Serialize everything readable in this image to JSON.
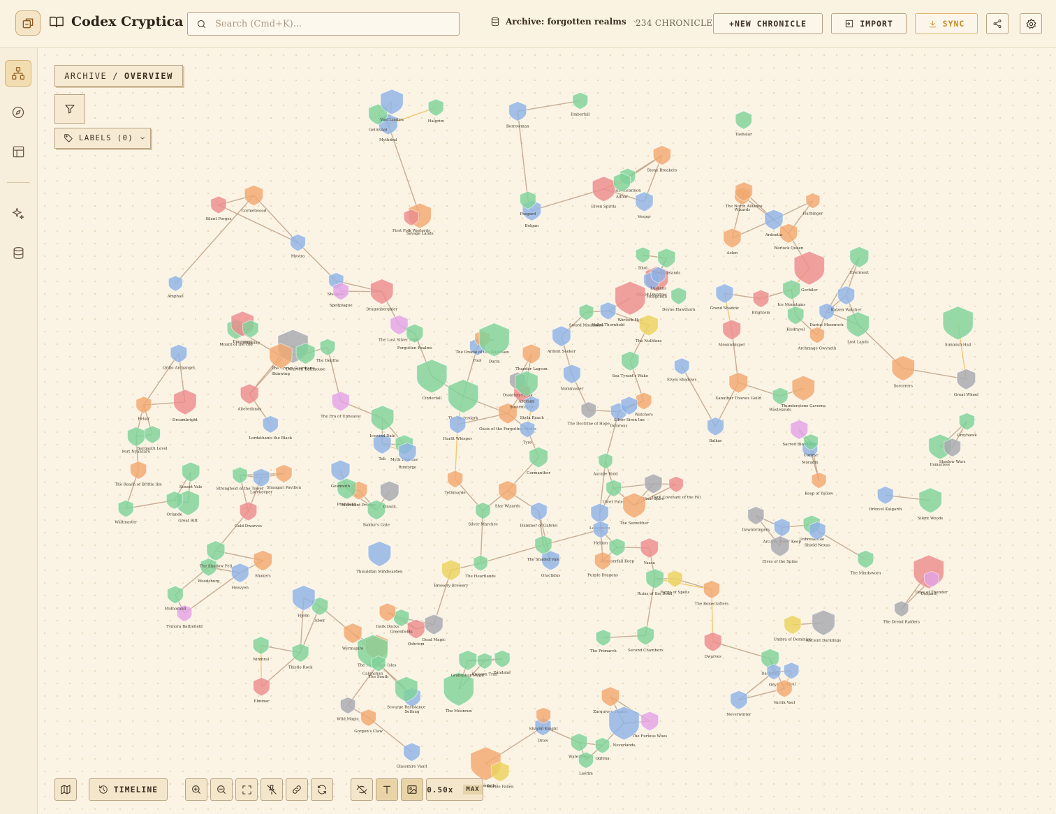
{
  "header": {
    "app_title": "Codex Cryptica",
    "search_placeholder": "Search (Cmd+K)...",
    "archive_label": "Archive: forgotten realms",
    "chronicle_count": "234 CHRONICLES",
    "new_chronicle_label": "+NEW CHRONICLE",
    "import_label": "IMPORT",
    "sync_label": "SYNC"
  },
  "rail": {
    "items": [
      "graph-view",
      "explore",
      "layout",
      "oracle",
      "database"
    ]
  },
  "canvas": {
    "breadcrumb_root": "ARCHIVE",
    "breadcrumb_sep": "/",
    "breadcrumb_current": "OVERVIEW",
    "labels_button": "LABELS (0)"
  },
  "toolbar": {
    "timeline_label": "TIMELINE",
    "zoom_value": "0.50x",
    "zoom_max": "MAX"
  },
  "colors": {
    "background": "#fbf4e4",
    "location": "#7fd39a",
    "character": "#8fb3e6",
    "item": "#f2a86f",
    "faction": "#ec8c8c",
    "event": "#a7aab0",
    "magic": "#e3a3e6",
    "lore": "#ecd35e",
    "link": "#b89a80",
    "highlight_link": "#f0c060",
    "accent": "#c58b24"
  },
  "graph_nodes": [
    {
      "label": "Ilsmarisse",
      "type": "location"
    },
    {
      "label": "Oractidus",
      "type": "character"
    },
    {
      "label": "Selfaug",
      "type": "character"
    },
    {
      "label": "Gerbilor",
      "type": "faction"
    },
    {
      "label": "Zarquivan Trader",
      "type": "item"
    },
    {
      "label": "Bolgan",
      "type": "character"
    },
    {
      "label": "Balkar",
      "type": "character"
    },
    {
      "label": "Tok",
      "type": "character"
    },
    {
      "label": "Brewery Brewery",
      "type": "lore"
    },
    {
      "label": "Dragonbergbier",
      "type": "faction"
    },
    {
      "label": "Hammerfall Keep",
      "type": "location"
    },
    {
      "label": "Waltmaster",
      "type": "location"
    },
    {
      "label": "Oshriem",
      "type": "faction"
    },
    {
      "label": "Xanathar Thieves Guild",
      "type": "item"
    },
    {
      "label": "Second Chambers",
      "type": "location"
    },
    {
      "label": "Auralie Hold",
      "type": "location"
    },
    {
      "label": "Brightem",
      "type": "faction"
    },
    {
      "label": "Grul",
      "type": "character"
    },
    {
      "label": "Hobgoblin",
      "type": "faction"
    },
    {
      "label": "Moradin",
      "type": "character"
    },
    {
      "label": "The Moonrun",
      "type": "location"
    },
    {
      "label": "Purple Dragons",
      "type": "item"
    },
    {
      "label": "Dark Covenant of the Fel",
      "type": "faction"
    },
    {
      "label": "Sargauth Level",
      "type": "location"
    },
    {
      "label": "Shagguit",
      "type": "character"
    },
    {
      "label": "Stone Breakers",
      "type": "item"
    },
    {
      "label": "Ice Mountains",
      "type": "location"
    },
    {
      "label": "The Moonshae Isles",
      "type": "item"
    },
    {
      "label": "Myth Drannor",
      "type": "location"
    },
    {
      "label": "Silent Forges",
      "type": "faction"
    },
    {
      "label": "Alteredimas",
      "type": "faction"
    },
    {
      "label": "Unicorn Trail",
      "type": "location"
    },
    {
      "label": "The Bonecrafters",
      "type": "item"
    },
    {
      "label": "Shield Dwarves",
      "type": "character"
    },
    {
      "label": "Dwarves",
      "type": "faction"
    },
    {
      "label": "Gold Dwarves",
      "type": "faction"
    },
    {
      "label": "Great Rift",
      "type": "location"
    },
    {
      "label": "Chondath",
      "type": "item"
    },
    {
      "label": "The Dread Raiders",
      "type": "event"
    },
    {
      "label": "Darthfall",
      "type": "location"
    },
    {
      "label": "Shieldcannon",
      "type": "location"
    },
    {
      "label": "The Primarch",
      "type": "location"
    },
    {
      "label": "Wizards",
      "type": "item"
    },
    {
      "label": "Wild Magic",
      "type": "event"
    },
    {
      "label": "Cormanthor",
      "type": "location"
    },
    {
      "label": "Elven Spirits",
      "type": "faction"
    },
    {
      "label": "The Heartlands",
      "type": "location"
    },
    {
      "label": "Star Wizards",
      "type": "item"
    },
    {
      "label": "Watchers",
      "type": "item"
    },
    {
      "label": "Dawnbringers",
      "type": "event"
    },
    {
      "label": "Abeir",
      "type": "location"
    },
    {
      "label": "Sacred Bloodline",
      "type": "magic"
    },
    {
      "label": "The Era of Upheaval",
      "type": "magic"
    },
    {
      "label": "Hallol Thornhold",
      "type": "character"
    },
    {
      "label": "The Crown Guardians",
      "type": "event"
    },
    {
      "label": "Dead Magic",
      "type": "event"
    },
    {
      "label": "The Reach of Brittle Inn",
      "type": "item"
    },
    {
      "label": "Woodsburg",
      "type": "location"
    },
    {
      "label": "Spellplague",
      "type": "magic"
    },
    {
      "label": "The Depths",
      "type": "location"
    },
    {
      "label": "Fool",
      "type": "character"
    },
    {
      "label": "Shadow Wars",
      "type": "event"
    },
    {
      "label": "The Doctrine of Hope",
      "type": "event"
    },
    {
      "label": "Sorcerers",
      "type": "item"
    },
    {
      "label": "Aelen",
      "type": "item"
    },
    {
      "label": "Evermeet",
      "type": "location"
    },
    {
      "label": "Greyhawk",
      "type": "location"
    },
    {
      "label": "The Dalelands",
      "type": "location"
    },
    {
      "label": "Vaasa",
      "type": "faction"
    },
    {
      "label": "Unbreakable",
      "type": "location"
    },
    {
      "label": "Wastelands",
      "type": "location"
    },
    {
      "label": "The Underdark",
      "type": "location"
    },
    {
      "label": "Savage Lands",
      "type": "item"
    },
    {
      "label": "The Lost Silver Army",
      "type": "magic"
    },
    {
      "label": "Ebon Spire",
      "type": "event"
    },
    {
      "label": "Tymora Battlefield",
      "type": "magic"
    },
    {
      "label": "Harfit Whisper",
      "type": "character"
    },
    {
      "label": "Luskans",
      "type": "character"
    },
    {
      "label": "Heavyen",
      "type": "character"
    },
    {
      "label": "Umbra of Dominion",
      "type": "lore"
    },
    {
      "label": "Elminar",
      "type": "faction"
    },
    {
      "label": "Dreambright",
      "type": "faction"
    },
    {
      "label": "Archmage Gwyneth",
      "type": "item"
    },
    {
      "label": "Oghma",
      "type": "location"
    },
    {
      "label": "Adbar",
      "type": "location"
    },
    {
      "label": "Tethmorde",
      "type": "item"
    },
    {
      "label": "Waterdeep",
      "type": "location"
    },
    {
      "label": "Cormyr",
      "type": "location"
    },
    {
      "label": "Calimshan",
      "type": "location"
    },
    {
      "label": "The Mindsworn",
      "type": "location"
    },
    {
      "label": "Scourge Resistance",
      "type": "location"
    },
    {
      "label": "Mount of the Old",
      "type": "location"
    },
    {
      "label": "Drow",
      "type": "character"
    },
    {
      "label": "Forgotten Realms",
      "type": "location"
    },
    {
      "label": "Mulhorand",
      "type": "location"
    },
    {
      "label": "Arcane Tower Keep",
      "type": "character"
    },
    {
      "label": "Thaedor Lagoon",
      "type": "item"
    },
    {
      "label": "Oasis of the Forgotten Realm",
      "type": "item"
    },
    {
      "label": "Great Wheel",
      "type": "event"
    },
    {
      "label": "Hjelm",
      "type": "character"
    },
    {
      "label": "Neverwinter",
      "type": "character"
    },
    {
      "label": "Nommaster",
      "type": "character"
    },
    {
      "label": "Onyx",
      "type": "character"
    },
    {
      "label": "Qrillo Archangel",
      "type": "character"
    },
    {
      "label": "Grandskar Magic",
      "type": "location"
    },
    {
      "label": "Delgard",
      "type": "faction"
    },
    {
      "label": "The South",
      "type": "location"
    },
    {
      "label": "The Furious Woes",
      "type": "magic"
    },
    {
      "label": "Emergent",
      "type": "faction"
    },
    {
      "label": "First Folk Warlords",
      "type": "faction"
    },
    {
      "label": "Cormetwood",
      "type": "item"
    },
    {
      "label": "Rimforge",
      "type": "character"
    },
    {
      "label": "The North Alliance",
      "type": "item"
    },
    {
      "label": "Mythdral",
      "type": "character"
    },
    {
      "label": "Vesper",
      "type": "character"
    },
    {
      "label": "Gelinvaal",
      "type": "location"
    },
    {
      "label": "Hammer of Gabriel",
      "type": "character"
    },
    {
      "label": "Ancient Darklings",
      "type": "event"
    },
    {
      "label": "Ruins of the Dead",
      "type": "location"
    },
    {
      "label": "Ulcer Fates",
      "type": "location"
    },
    {
      "label": "Amphail",
      "type": "character"
    },
    {
      "label": "Elves of the Spine",
      "type": "event"
    },
    {
      "label": "Neverlands",
      "type": "character"
    },
    {
      "label": "Dhol",
      "type": "location"
    },
    {
      "label": "Dolorous",
      "type": "character"
    },
    {
      "label": "Sword Mountains",
      "type": "location"
    },
    {
      "label": "Thunderstone Caverns",
      "type": "item"
    },
    {
      "label": "Fosgard",
      "type": "location"
    },
    {
      "label": "Port Nyanzaru",
      "type": "location"
    },
    {
      "label": "Merchant Princes",
      "type": "item"
    },
    {
      "label": "Tashalar",
      "type": "location"
    },
    {
      "label": "Baldur's Gate",
      "type": "location"
    },
    {
      "label": "Sunset Vale",
      "type": "location"
    },
    {
      "label": "Kisdravel",
      "type": "location"
    },
    {
      "label": "Nimbral",
      "type": "location"
    },
    {
      "label": "Silent Woods",
      "type": "location"
    },
    {
      "label": "Laerim",
      "type": "location"
    },
    {
      "label": "The Shadow Fell",
      "type": "location"
    },
    {
      "label": "Stonemantle",
      "type": "faction"
    },
    {
      "label": "Warlock Hall",
      "type": "faction"
    },
    {
      "label": "Silver Marches",
      "type": "location"
    },
    {
      "label": "Stronghold of the Tower",
      "type": "location"
    },
    {
      "label": "Glassmire Vault",
      "type": "character"
    },
    {
      "label": "Phandalin",
      "type": "location"
    },
    {
      "label": "Skinwing",
      "type": "item"
    },
    {
      "label": "Beluir",
      "type": "item"
    },
    {
      "label": "Harbinger",
      "type": "item"
    },
    {
      "label": "Gorgon's Claw",
      "type": "item"
    },
    {
      "label": "Wyrmspire",
      "type": "item"
    },
    {
      "label": "Ironspike",
      "type": "location"
    },
    {
      "label": "Warlock Queen",
      "type": "item"
    },
    {
      "label": "Varrik Vael",
      "type": "item"
    },
    {
      "label": "Orlande",
      "type": "location"
    },
    {
      "label": "Icewind Dale",
      "type": "location"
    },
    {
      "label": "Skyla Reach",
      "type": "character"
    },
    {
      "label": "Dwarven Bathhouse",
      "type": "location"
    },
    {
      "label": "Cinderfall",
      "type": "location"
    },
    {
      "label": "Emberfall",
      "type": "location"
    },
    {
      "label": "The Shaded Vale",
      "type": "location"
    },
    {
      "label": "Sea Tyrant's Wake",
      "type": "location"
    },
    {
      "label": "Greenfields",
      "type": "location"
    },
    {
      "label": "Keep of Yellow",
      "type": "item"
    },
    {
      "label": "Lost Lands",
      "type": "location"
    },
    {
      "label": "Geunnoth",
      "type": "character"
    },
    {
      "label": "Ossarion Fonsk",
      "type": "event"
    },
    {
      "label": "Days of Thunder",
      "type": "magic"
    },
    {
      "label": "Shuagari Pavilion",
      "type": "item"
    },
    {
      "label": "Zandalar",
      "type": "location"
    },
    {
      "label": "Shakers",
      "type": "item"
    },
    {
      "label": "Dark Ducks",
      "type": "item"
    },
    {
      "label": "Lakeshore",
      "type": "character"
    },
    {
      "label": "The Sunwither",
      "type": "item"
    },
    {
      "label": "The Oracle of the Guardian",
      "type": "item"
    },
    {
      "label": "Sunmish Hall",
      "type": "location"
    },
    {
      "label": "Darius Moonrock",
      "type": "character"
    },
    {
      "label": "Onwill",
      "type": "event"
    },
    {
      "label": "Shaylin Knight",
      "type": "item"
    },
    {
      "label": "Silver Siren Inn",
      "type": "character"
    },
    {
      "label": "Kalzen Watcher",
      "type": "character"
    },
    {
      "label": "Marble Fallen",
      "type": "lore"
    },
    {
      "label": "Vael Lindira",
      "type": "character"
    },
    {
      "label": "Mystra",
      "type": "character"
    },
    {
      "label": "Hellion",
      "type": "character"
    },
    {
      "label": "Tyre",
      "type": "character"
    },
    {
      "label": "Grand Shadow",
      "type": "character"
    },
    {
      "label": "Moonwhisper",
      "type": "faction"
    },
    {
      "label": "Lorekeeper",
      "type": "character"
    },
    {
      "label": "Elven Shadows",
      "type": "character"
    },
    {
      "label": "Thistle Rock",
      "type": "location"
    },
    {
      "label": "Azerium",
      "type": "location"
    },
    {
      "label": "Durin",
      "type": "location"
    },
    {
      "label": "Halgrim",
      "type": "location"
    },
    {
      "label": "Ardentia",
      "type": "character"
    },
    {
      "label": "Borrowman",
      "type": "character"
    },
    {
      "label": "Drexvel Kalgarin",
      "type": "character"
    },
    {
      "label": "Deyne Hawthorn",
      "type": "location"
    },
    {
      "label": "Lordathanis the Black",
      "type": "character"
    },
    {
      "label": "The Nullifans",
      "type": "lore"
    },
    {
      "label": "Thisuldian Mindwarden",
      "type": "character"
    },
    {
      "label": "Shield Nexus",
      "type": "character"
    },
    {
      "label": "Ardent Seeker",
      "type": "character"
    },
    {
      "label": "Forge of Spells",
      "type": "lore"
    }
  ]
}
